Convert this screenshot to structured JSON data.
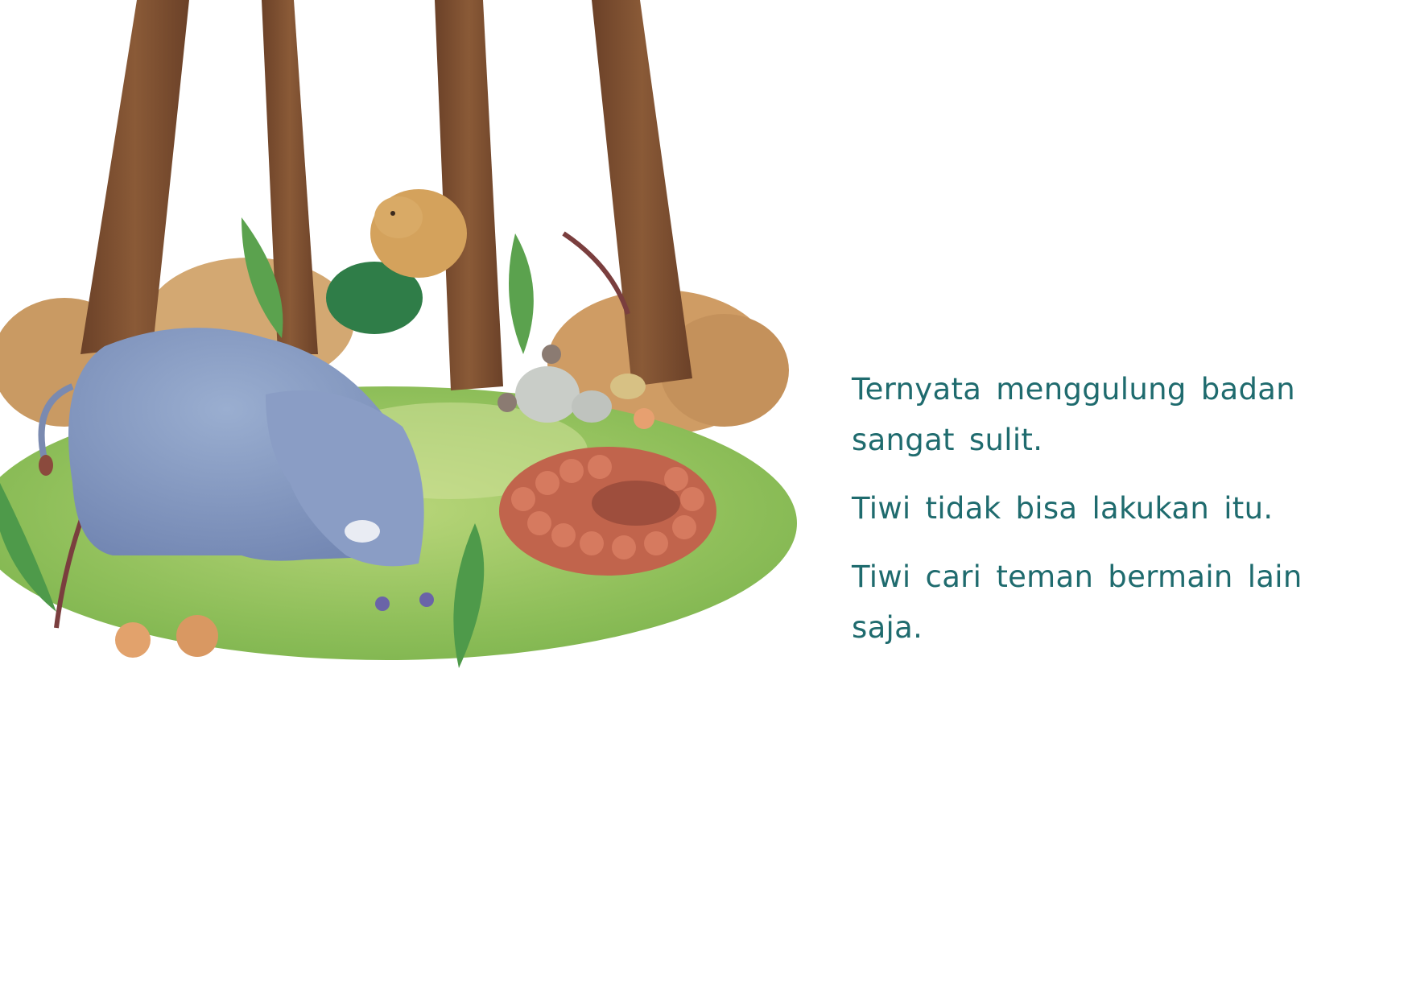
{
  "page": {
    "background_color": "#ffffff",
    "text_color": "#1f6b6e"
  },
  "illustration": {
    "subject": "elephant, pangolin curled into a ball, small animals and trees in a forest clearing"
  },
  "story": {
    "paragraphs": [
      "Ternyata menggulung badan sangat sulit.",
      "Tiwi tidak bisa lakukan itu.",
      "Tiwi cari teman bermain lain saja."
    ]
  }
}
